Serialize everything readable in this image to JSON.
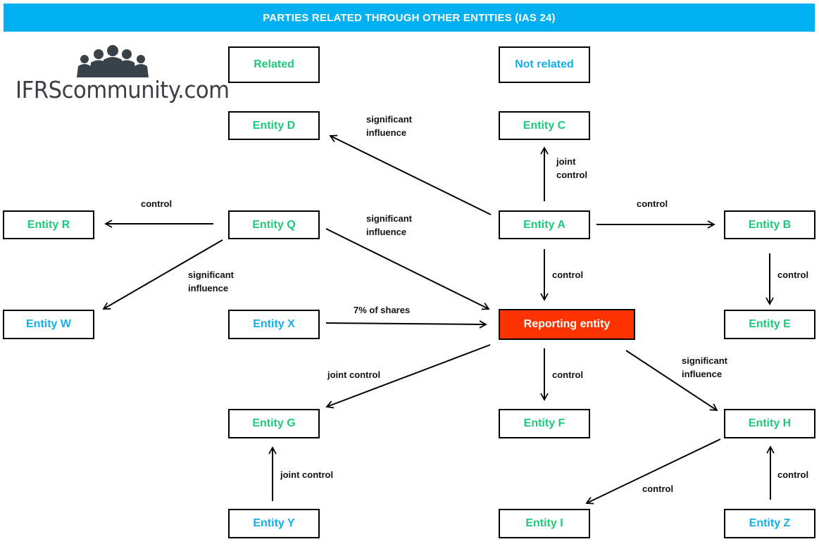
{
  "header": {
    "title": "PARTIES RELATED THROUGH OTHER ENTITIES (IAS 24)"
  },
  "logo": {
    "text": "IFRScommunity.com",
    "icon": "people-group-icon"
  },
  "legend": {
    "related": {
      "label": "Related",
      "color": "#1fc97a"
    },
    "not_related": {
      "label": "Not related",
      "color": "#14aee6"
    }
  },
  "colors": {
    "header": "#00b0f0",
    "reporting": "#ff3300",
    "related": "#1fc97a",
    "not_related": "#14aee6"
  },
  "entities": {
    "D": {
      "label": "Entity D",
      "status": "related"
    },
    "C": {
      "label": "Entity C",
      "status": "related"
    },
    "R": {
      "label": "Entity R",
      "status": "related"
    },
    "Q": {
      "label": "Entity Q",
      "status": "related"
    },
    "A": {
      "label": "Entity A",
      "status": "related"
    },
    "B": {
      "label": "Entity B",
      "status": "related"
    },
    "W": {
      "label": "Entity W",
      "status": "not_related"
    },
    "X": {
      "label": "Entity X",
      "status": "not_related"
    },
    "REP": {
      "label": "Reporting entity",
      "status": "reporting"
    },
    "E": {
      "label": "Entity E",
      "status": "related"
    },
    "G": {
      "label": "Entity G",
      "status": "related"
    },
    "F": {
      "label": "Entity F",
      "status": "related"
    },
    "H": {
      "label": "Entity H",
      "status": "related"
    },
    "Y": {
      "label": "Entity Y",
      "status": "not_related"
    },
    "I": {
      "label": "Entity I",
      "status": "related"
    },
    "Z": {
      "label": "Entity Z",
      "status": "not_related"
    }
  },
  "relations": [
    {
      "from": "A",
      "to": "D",
      "label": "significant\ninfluence"
    },
    {
      "from": "A",
      "to": "C",
      "label": "joint\ncontrol"
    },
    {
      "from": "A",
      "to": "B",
      "label": "control"
    },
    {
      "from": "A",
      "to": "REP",
      "label": "control"
    },
    {
      "from": "Q",
      "to": "R",
      "label": "control"
    },
    {
      "from": "Q",
      "to": "REP",
      "label": "significant\ninfluence"
    },
    {
      "from": "Q",
      "to": "W",
      "label": "significant\ninfluence"
    },
    {
      "from": "X",
      "to": "REP",
      "label": "7% of shares"
    },
    {
      "from": "B",
      "to": "E",
      "label": "control"
    },
    {
      "from": "REP",
      "to": "G",
      "label": "joint control"
    },
    {
      "from": "REP",
      "to": "F",
      "label": "control"
    },
    {
      "from": "REP",
      "to": "H",
      "label": "significant\ninfluence"
    },
    {
      "from": "Y",
      "to": "G",
      "label": "joint control"
    },
    {
      "from": "H",
      "to": "I",
      "label": "control"
    },
    {
      "from": "Z",
      "to": "H",
      "label": "control"
    }
  ]
}
